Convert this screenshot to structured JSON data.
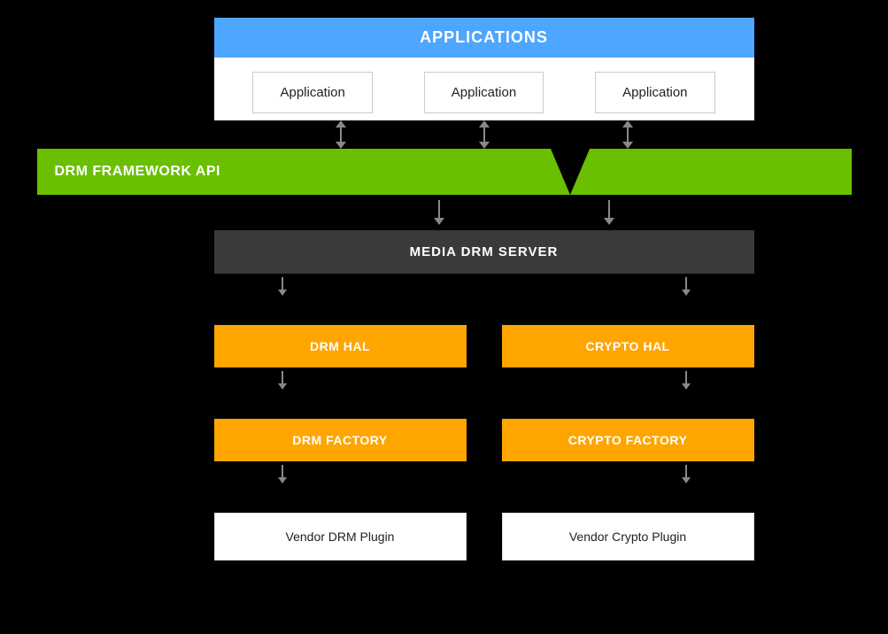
{
  "diagram": {
    "applications": {
      "header": "APPLICATIONS",
      "app1": "Application",
      "app2": "Application",
      "app3": "Application"
    },
    "drm_framework": {
      "label": "DRM FRAMEWORK API"
    },
    "media_drm_server": {
      "label": "MEDIA DRM SERVER"
    },
    "drm_hal": {
      "label": "DRM HAL"
    },
    "crypto_hal": {
      "label": "CRYPTO HAL"
    },
    "drm_factory": {
      "label": "DRM FACTORY"
    },
    "crypto_factory": {
      "label": "CRYPTO FACTORY"
    },
    "vendor_drm_plugin": {
      "label": "Vendor DRM Plugin"
    },
    "vendor_crypto_plugin": {
      "label": "Vendor Crypto Plugin"
    }
  },
  "colors": {
    "blue": "#4da6ff",
    "green": "#6abf00",
    "orange": "#ffa500",
    "dark_gray": "#3a3a3a",
    "white": "#ffffff",
    "black": "#000000"
  }
}
